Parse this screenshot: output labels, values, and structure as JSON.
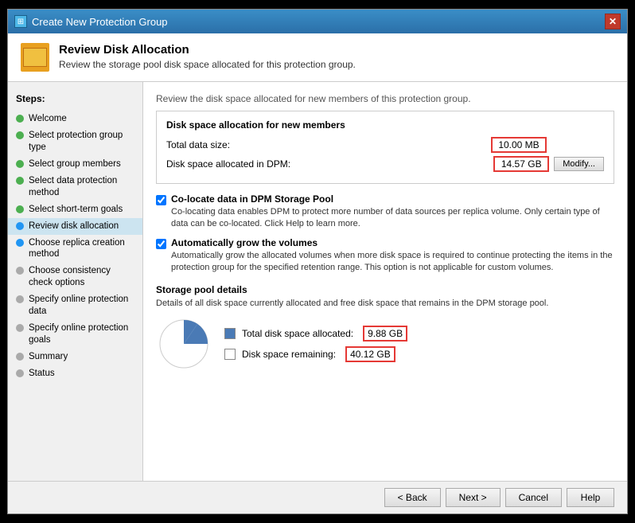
{
  "window": {
    "title": "Create New Protection Group",
    "icon": "dpm-icon"
  },
  "header": {
    "title": "Review Disk Allocation",
    "description": "Review the storage pool disk space allocated for this protection group."
  },
  "sidebar": {
    "steps_label": "Steps:",
    "items": [
      {
        "id": "welcome",
        "label": "Welcome",
        "status": "green"
      },
      {
        "id": "select-protection-group-type",
        "label": "Select protection group type",
        "status": "green"
      },
      {
        "id": "select-group-members",
        "label": "Select group members",
        "status": "green"
      },
      {
        "id": "select-data-protection-method",
        "label": "Select data protection method",
        "status": "green"
      },
      {
        "id": "select-short-term-goals",
        "label": "Select short-term goals",
        "status": "green"
      },
      {
        "id": "review-disk-allocation",
        "label": "Review disk allocation",
        "status": "blue",
        "active": true
      },
      {
        "id": "choose-replica-creation-method",
        "label": "Choose replica creation method",
        "status": "blue"
      },
      {
        "id": "choose-consistency-check-options",
        "label": "Choose consistency check options",
        "status": "gray"
      },
      {
        "id": "specify-online-protection-data",
        "label": "Specify online protection data",
        "status": "gray"
      },
      {
        "id": "specify-online-protection-goals",
        "label": "Specify online protection goals",
        "status": "gray"
      },
      {
        "id": "summary",
        "label": "Summary",
        "status": "gray"
      },
      {
        "id": "status",
        "label": "Status",
        "status": "gray"
      }
    ]
  },
  "main": {
    "intro_text": "Review the disk space allocated for new members of this protection group.",
    "allocation_box": {
      "title": "Disk space allocation for new members",
      "total_data_label": "Total data size:",
      "total_data_value": "10.00 MB",
      "disk_space_label": "Disk space allocated in DPM:",
      "disk_space_value": "14.57 GB",
      "modify_label": "Modify..."
    },
    "colocate_checkbox": {
      "checked": true,
      "label": "Co-locate data in DPM Storage Pool",
      "description": "Co-locating data enables DPM to protect more number of data sources per replica volume. Only certain type of data can be co-located. Click Help to learn more."
    },
    "auto_grow_checkbox": {
      "checked": true,
      "label": "Automatically grow the volumes",
      "description": "Automatically grow the allocated volumes when more disk space is required to continue protecting the items in the protection group for the specified retention range. This option is not applicable for custom volumes."
    },
    "storage_pool": {
      "title": "Storage pool details",
      "description": "Details of all disk space currently allocated and free disk space that remains in the DPM storage pool.",
      "allocated_label": "Total disk space allocated:",
      "allocated_value": "9.88 GB",
      "remaining_label": "Disk space remaining:",
      "remaining_value": "40.12 GB",
      "pie": {
        "allocated_percent": 20,
        "remaining_percent": 80
      }
    }
  },
  "footer": {
    "back_label": "< Back",
    "next_label": "Next >",
    "cancel_label": "Cancel",
    "help_label": "Help"
  }
}
